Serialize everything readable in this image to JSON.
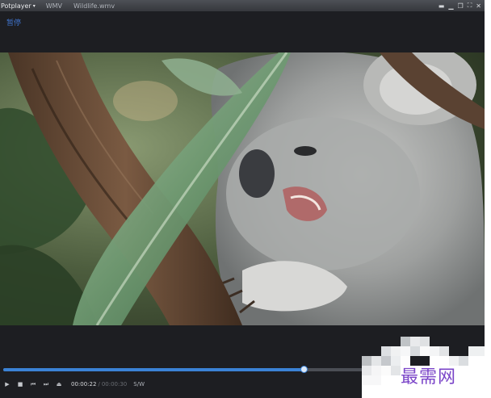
{
  "titlebar": {
    "app_menu": "Potplayer",
    "app_menu_caret": "▾",
    "items": [
      "WMV",
      "Wildlife.wmv"
    ],
    "controls": [
      "▬",
      "▁",
      "❐",
      "⛶",
      "✕"
    ]
  },
  "osd": {
    "status": "暂停"
  },
  "playback": {
    "current_time": "00:00:22",
    "separator": "/",
    "duration": "00:00:30",
    "progress": 0.63,
    "mode": "S/W"
  },
  "controls": {
    "play_icon": "▶",
    "stop_icon": "■",
    "prev_icon": "⏮",
    "next_icon": "⏭",
    "eject_icon": "⏏"
  },
  "watermark": "最需网",
  "colors": {
    "accent": "#3b82d6",
    "background": "#1d1e22",
    "watermark": "#7a44c8"
  }
}
